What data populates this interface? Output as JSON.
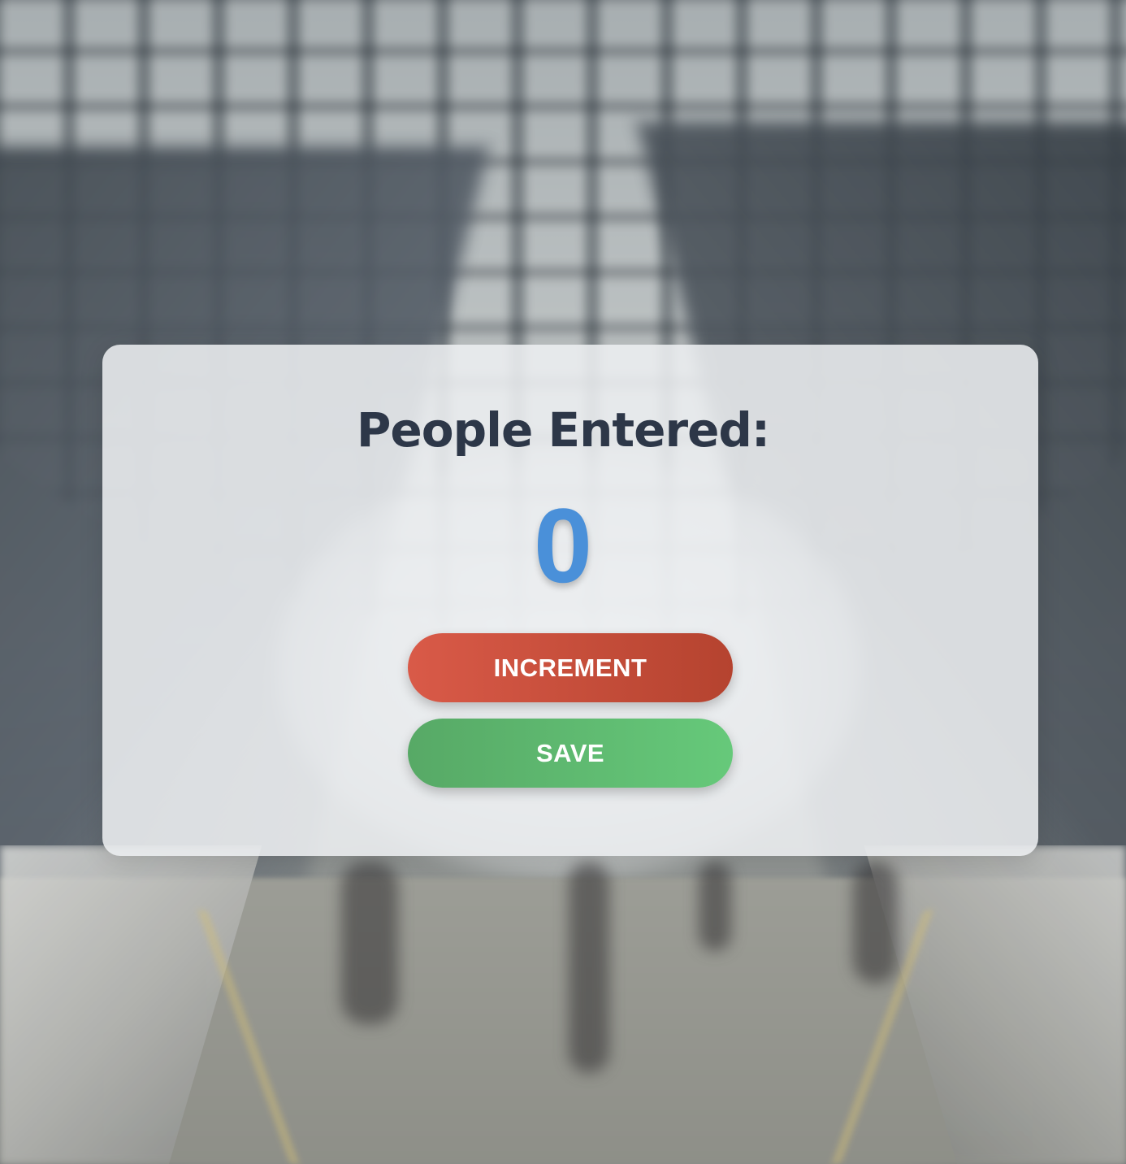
{
  "background": {
    "description_icon": "train-station-background"
  },
  "card": {
    "title": "People Entered:",
    "count": "0",
    "increment_label": "INCREMENT",
    "save_label": "SAVE"
  },
  "colors": {
    "title": "#2d3748",
    "count": "#4a90d9",
    "increment_button": "#d25240",
    "save_button": "#5cb86d"
  }
}
